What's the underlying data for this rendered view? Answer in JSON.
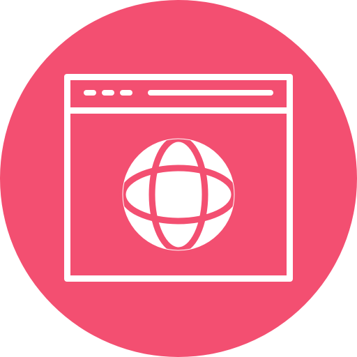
{
  "icon": {
    "name": "web-browser-globe-icon",
    "colors": {
      "background_circle": "#f34f71",
      "foreground": "#ffffff"
    },
    "parts": {
      "window": "browser-window",
      "address_bar": "address-bar",
      "window_dots": [
        "dot",
        "dot",
        "dot"
      ],
      "glyph": "globe"
    }
  }
}
